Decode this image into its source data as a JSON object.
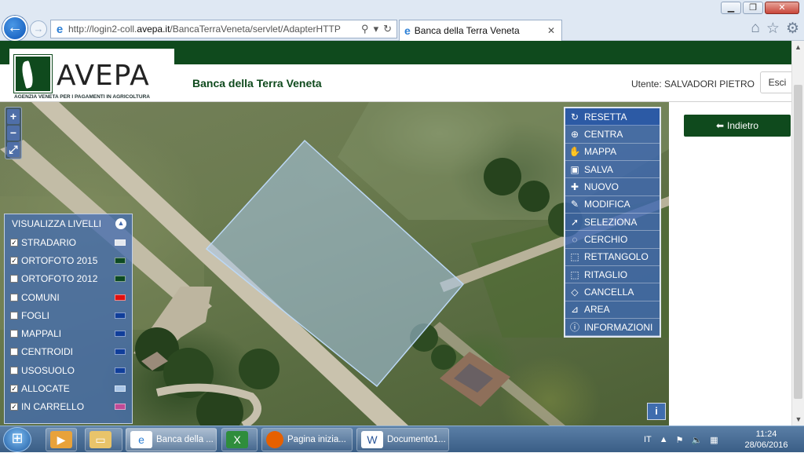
{
  "browser": {
    "url_prefix": "http://login2-coll.",
    "url_domain": "avepa.it",
    "url_path": "/BancaTerraVeneta/servlet/AdapterHTTP",
    "tab_title": "Banca della Terra Veneta"
  },
  "header": {
    "logo_word": "AVEPA",
    "logo_sub": "AGENZIA VENETA PER I PAGAMENTI IN AGRICOLTURA",
    "app_title": "Banca della Terra Veneta",
    "user": "Utente: SALVADORI PIETRO",
    "exit_label": "Esci"
  },
  "back_label": "Indietro",
  "layers_panel": {
    "title": "VISUALIZZA LIVELLI",
    "items": [
      {
        "label": "STRADARIO",
        "checked": true,
        "color": "#e4e7ee"
      },
      {
        "label": "ORTOFOTO 2015",
        "checked": true,
        "color": "#0d4a22"
      },
      {
        "label": "ORTOFOTO 2012",
        "checked": false,
        "color": "#0d4a22"
      },
      {
        "label": "COMUNI",
        "checked": false,
        "color": "#e01010"
      },
      {
        "label": "FOGLI",
        "checked": false,
        "color": "#103e9a"
      },
      {
        "label": "MAPPALI",
        "checked": false,
        "color": "#103e9a"
      },
      {
        "label": "CENTROIDI",
        "checked": false,
        "color": "#103e9a"
      },
      {
        "label": "USOSUOLO",
        "checked": false,
        "color": "#103e9a"
      },
      {
        "label": "ALLOCATE",
        "checked": true,
        "color": "#a9c6e8"
      },
      {
        "label": "IN CARRELLO",
        "checked": true,
        "color": "#c04a96"
      }
    ]
  },
  "tools_panel": {
    "items": [
      {
        "label": "RESETTA",
        "icon": "reset-icon",
        "glyph": "↻"
      },
      {
        "label": "CENTRA",
        "icon": "center-icon",
        "glyph": "⊕"
      },
      {
        "label": "MAPPA",
        "icon": "hand-icon",
        "glyph": "✋"
      },
      {
        "label": "SALVA",
        "icon": "save-icon",
        "glyph": "▣"
      },
      {
        "label": "NUOVO",
        "icon": "plus-icon",
        "glyph": "✚"
      },
      {
        "label": "MODIFICA",
        "icon": "pencil-icon",
        "glyph": "✎"
      },
      {
        "label": "SELEZIONA",
        "icon": "cursor-icon",
        "glyph": "➚"
      },
      {
        "label": "CERCHIO",
        "icon": "circle-icon",
        "glyph": "◌"
      },
      {
        "label": "RETTANGOLO",
        "icon": "rectangle-icon",
        "glyph": "⬚"
      },
      {
        "label": "RITAGLIO",
        "icon": "crop-icon",
        "glyph": "⬚"
      },
      {
        "label": "CANCELLA",
        "icon": "eraser-icon",
        "glyph": "◇"
      },
      {
        "label": "AREA",
        "icon": "area-icon",
        "glyph": "⊿"
      },
      {
        "label": "INFORMAZIONI",
        "icon": "info-icon",
        "glyph": "ⓘ"
      }
    ]
  },
  "map": {
    "zoom_in": "+",
    "zoom_out": "−",
    "fullscreen": "⤢",
    "info": "i"
  },
  "taskbar": {
    "items": [
      {
        "label": "Banca della ...",
        "icon": "ie-icon"
      },
      {
        "label": "Pagina inizia...",
        "icon": "firefox-icon"
      },
      {
        "label": "Documento1...",
        "icon": "word-icon"
      }
    ],
    "language": "IT",
    "time": "11:24",
    "date": "28/06/2016"
  }
}
